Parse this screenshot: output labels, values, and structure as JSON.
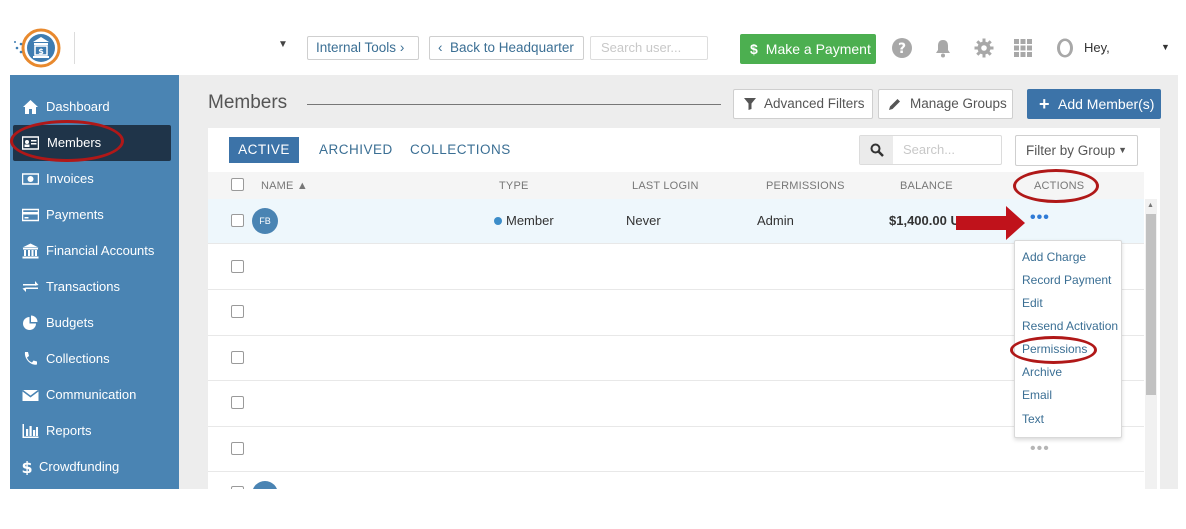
{
  "topbar": {
    "internal_tools": "Internal Tools",
    "internal_tools_arrow": "›",
    "back_arrow": "‹",
    "back_label": "Back to Headquarter",
    "search_placeholder": "Search user...",
    "payment_icon": "$",
    "payment_label": "Make a Payment",
    "greeting": "Hey,",
    "icons": [
      "help-icon",
      "bell-icon",
      "gear-icon",
      "apps-grid-icon",
      "user-icon"
    ]
  },
  "sidebar": {
    "items": [
      {
        "label": "Dashboard",
        "icon": "home-icon"
      },
      {
        "label": "Members",
        "icon": "id-card-icon",
        "active": true
      },
      {
        "label": "Invoices",
        "icon": "bill-icon"
      },
      {
        "label": "Payments",
        "icon": "credit-card-icon"
      },
      {
        "label": "Financial Accounts",
        "icon": "bank-icon"
      },
      {
        "label": "Transactions",
        "icon": "exchange-icon"
      },
      {
        "label": "Budgets",
        "icon": "pie-chart-icon"
      },
      {
        "label": "Collections",
        "icon": "phone-icon"
      },
      {
        "label": "Communication",
        "icon": "envelope-icon"
      },
      {
        "label": "Reports",
        "icon": "bar-chart-icon"
      },
      {
        "label": "Crowdfunding",
        "icon": "dollar-icon"
      }
    ]
  },
  "page": {
    "title": "Members",
    "advanced_filters": "Advanced Filters",
    "manage_groups": "Manage Groups",
    "add_members": "Add Member(s)"
  },
  "tabs": [
    "ACTIVE",
    "ARCHIVED",
    "COLLECTIONS"
  ],
  "search": {
    "placeholder": "Search..."
  },
  "filter_by_group": "Filter by Group",
  "table": {
    "columns": [
      "NAME",
      "TYPE",
      "LAST LOGIN",
      "PERMISSIONS",
      "BALANCE",
      "ACTIONS"
    ],
    "rows": [
      {
        "initials": "FB",
        "type": "Member",
        "last_login": "Never",
        "permissions": "Admin",
        "balance": "$1,400.00 US"
      }
    ]
  },
  "actions_menu": [
    "Add Charge",
    "Record Payment",
    "Edit",
    "Resend Activation",
    "Permissions",
    "Archive",
    "Email",
    "Text"
  ],
  "colors": {
    "sidebar": "#4a84b3",
    "sidebar_active": "#1f3449",
    "primary": "#3c73a8",
    "success": "#4caf50",
    "annotation": "#b01818"
  }
}
